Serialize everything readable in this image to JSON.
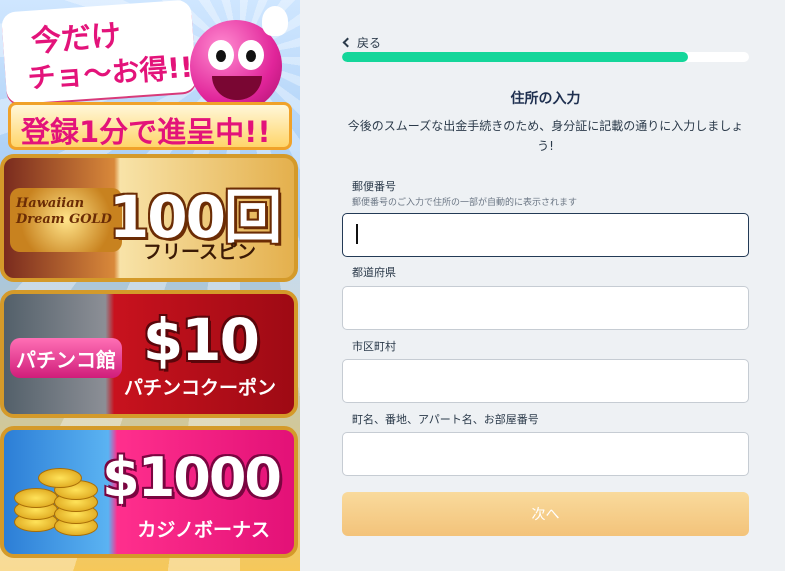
{
  "promo": {
    "headline_line1": "今だけ",
    "headline_line2": "チョ〜お得!!",
    "ribbon": "登録1分で進呈中!!",
    "cards": [
      {
        "logo_text": "Hawaiian Dream GOLD",
        "amount": "100回",
        "subtitle": "フリースピン"
      },
      {
        "logo_text": "パチンコ館",
        "amount": "$10",
        "subtitle": "パチンコクーポン"
      },
      {
        "logo_text": "",
        "amount": "$1000",
        "subtitle": "カジノボーナス"
      }
    ]
  },
  "nav": {
    "back_label": "戻る"
  },
  "progress": {
    "fraction": 0.85
  },
  "form": {
    "title": "住所の入力",
    "description": "今後のスムーズな出金手続きのため、身分証に記載の通りに入力しましょう!",
    "fields": [
      {
        "label": "郵便番号",
        "hint": "郵便番号のご入力で住所の一部が自動的に表示されます",
        "value": ""
      },
      {
        "label": "都道府県",
        "value": ""
      },
      {
        "label": "市区町村",
        "value": ""
      },
      {
        "label": "町名、番地、アパート名、お部屋番号",
        "value": ""
      }
    ],
    "next_label": "次へ"
  },
  "colors": {
    "accent": "#14d69a",
    "button": "#f3c37a",
    "focus_border": "#233a56"
  }
}
